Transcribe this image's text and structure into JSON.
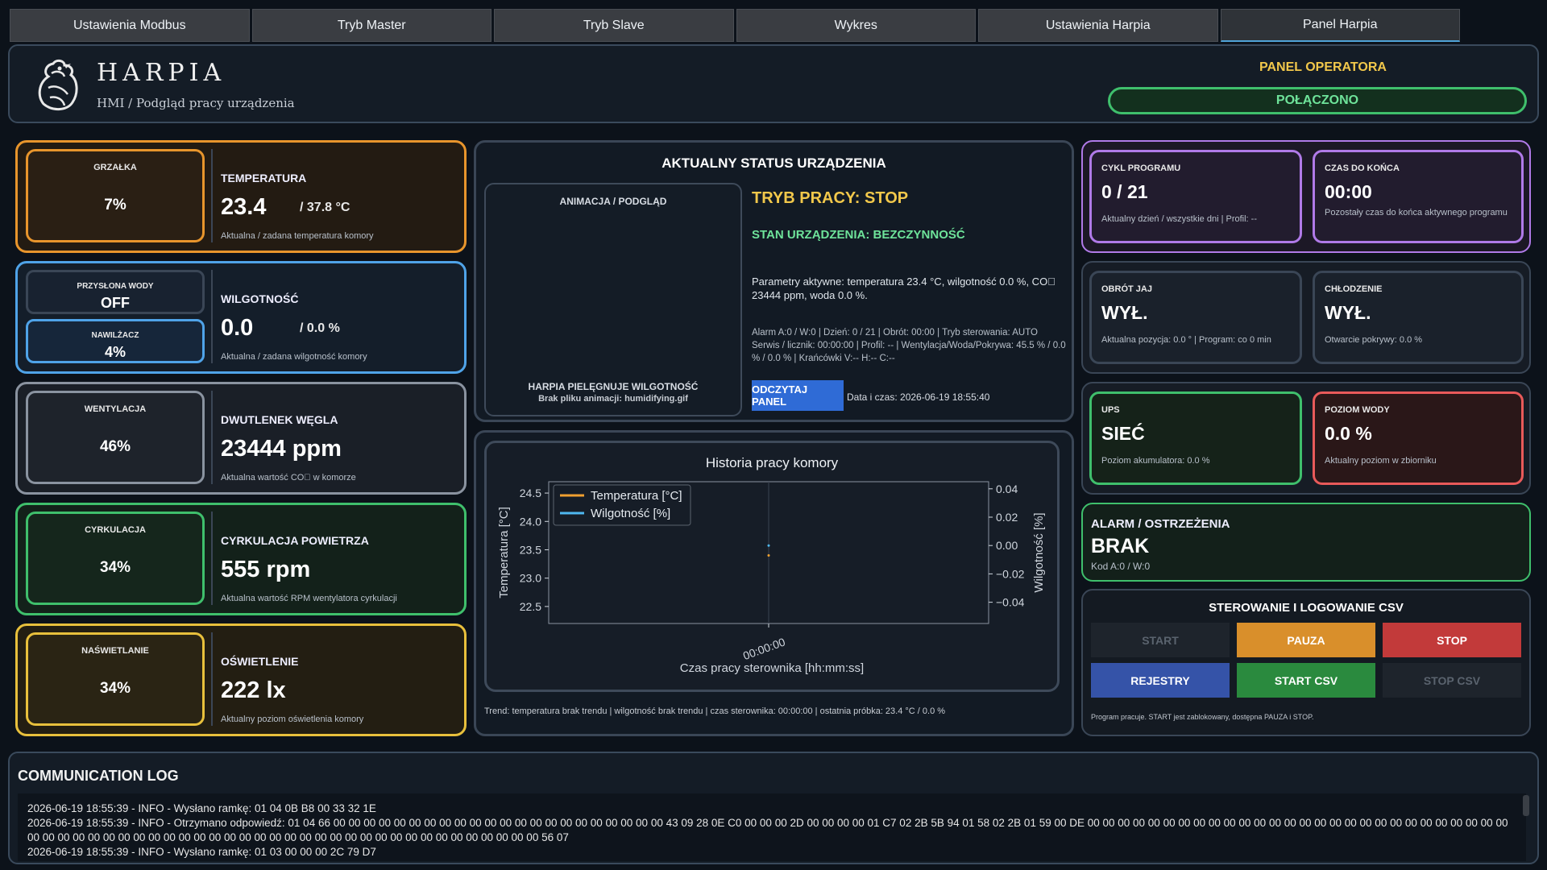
{
  "tabs": [
    "Ustawienia Modbus",
    "Tryb Master",
    "Tryb Slave",
    "Wykres",
    "Ustawienia Harpia",
    "Panel Harpia"
  ],
  "header": {
    "brand": "HARPIA",
    "subtitle": "HMI / Podgląd pracy urządzenia",
    "panel_title": "PANEL OPERATORA",
    "connection": "POŁĄCZONO",
    "logo_icon": "harpy-bird-logo"
  },
  "left": {
    "temp": {
      "mini_title": "GRZAŁKA",
      "mini_value": "7%",
      "label": "TEMPERATURA",
      "value": "23.4",
      "setpoint": "/  37.8 °C",
      "desc": "Aktualna / zadana temperatura komory",
      "color": "#e8952c"
    },
    "hum": {
      "mini1_title": "PRZYSŁONA WODY",
      "mini1_value": "OFF",
      "mini2_title": "NAWILŻACZ",
      "mini2_value": "4%",
      "label": "WILGOTNOŚĆ",
      "value": "0.0",
      "setpoint": "/  0.0 %",
      "desc": "Aktualna / zadana wilgotność komory",
      "color": "#4fa3e8"
    },
    "co2": {
      "mini_title": "WENTYLACJA",
      "mini_value": "46%",
      "label": "DWUTLENEK WĘGLA",
      "value": "23444 ppm",
      "desc": "Aktualna wartość CO⃞ w komorze",
      "color": "#8a93a0"
    },
    "circ": {
      "mini_title": "CYRKULACJA",
      "mini_value": "34%",
      "label": "CYRKULACJA POWIETRZA",
      "value": "555 rpm",
      "desc": "Aktualna wartość RPM wentylatora cyrkulacji",
      "color": "#3fbf6c"
    },
    "light": {
      "mini_title": "NAŚWIETLANIE",
      "mini_value": "34%",
      "label": "OŚWIETLENIE",
      "value": "222 lx",
      "desc": "Aktualny poziom oświetlenia komory",
      "color": "#e8c03c"
    }
  },
  "status": {
    "title": "AKTUALNY STATUS URZĄDZENIA",
    "anim_title": "ANIMACJA / PODGLĄD",
    "anim_caption": "HARPIA PIELĘGNUJE WILGOTNOŚĆ",
    "anim_missing": "Brak pliku animacji: humidifying.gif",
    "mode": "TRYB PRACY: STOP",
    "state": "STAN URZĄDZENIA: BEZCZYNNOŚĆ",
    "params": "Parametry aktywne: temperatura 23.4 °C, wilgotność 0.0 %, CO⃞ 23444 ppm, woda 0.0 %.",
    "meta": "Alarm A:0 / W:0  |  Dzień: 0 / 21  |  Obrót: 00:00  |  Tryb sterowania: AUTO\nSerwis / licznik: 00:00:00  |  Profil: --  |  Wentylacja/Woda/Pokrywa: 45.5 % / 0.0 % / 0.0 %  |  Krańcówki V:-- H:-- C:--",
    "read_button": "ODCZYTAJ PANEL",
    "datetime": "Data i czas: 2026-06-19  18:55:40"
  },
  "chart_data": {
    "type": "line",
    "title": "Historia pracy komory",
    "xlabel": "Czas pracy sterownika [hh:mm:ss]",
    "ylabel": "Temperatura [°C]",
    "y2label": "Wilgotność [%]",
    "x_ticks": [
      "00:00:00"
    ],
    "y_ticks": [
      "22.5",
      "23.0",
      "23.5",
      "24.0",
      "24.5"
    ],
    "y2_ticks": [
      "−0.04",
      "−0.02",
      "0.00",
      "0.02",
      "0.04"
    ],
    "ylim": [
      22.2,
      24.7
    ],
    "y2lim": [
      -0.055,
      0.045
    ],
    "series": [
      {
        "name": "Temperatura [°C]",
        "color": "#f0a030",
        "x": [
          "00:00:00"
        ],
        "values": [
          23.4
        ]
      },
      {
        "name": "Wilgotność [%]",
        "color": "#4fb8f0",
        "x": [
          "00:00:00"
        ],
        "values": [
          0.0
        ]
      }
    ],
    "legend": "top-left",
    "grid": true
  },
  "trend": "Trend: temperatura brak trendu  |  wilgotność brak trendu  |  czas sterownika: 00:00:00  |  ostatnia próbka: 23.4 °C / 0.0 %",
  "right": {
    "cycle": {
      "title": "CYKL PROGRAMU",
      "value": "0 / 21",
      "desc": "Aktualny dzień / wszystkie dni  |  Profil: --"
    },
    "remaining": {
      "title": "CZAS DO KOŃCA",
      "value": "00:00",
      "desc": "Pozostały czas do końca aktywnego programu"
    },
    "turn": {
      "title": "OBRÓT JAJ",
      "value": "WYŁ.",
      "desc": "Aktualna pozycja: 0.0 °  |  Program: co 0 min"
    },
    "cool": {
      "title": "CHŁODZENIE",
      "value": "WYŁ.",
      "desc": "Otwarcie pokrywy: 0.0 %"
    },
    "ups": {
      "title": "UPS",
      "value": "SIEĆ",
      "desc": "Poziom akumulatora: 0.0 %"
    },
    "water": {
      "title": "POZIOM WODY",
      "value": "0.0 %",
      "desc": "Aktualny poziom w zbiorniku"
    },
    "alarm": {
      "title": "ALARM / OSTRZEŻENIA",
      "value": "BRAK",
      "desc": "Kod A:0 / W:0"
    },
    "controls": {
      "title": "STEROWANIE I LOGOWANIE CSV",
      "start": "START",
      "pause": "PAUZA",
      "stop": "STOP",
      "registers": "REJESTRY",
      "start_csv": "START CSV",
      "stop_csv": "STOP CSV",
      "note": "Program pracuje. START jest zablokowany, dostępna PAUZA i STOP."
    }
  },
  "log": {
    "title": "COMMUNICATION LOG",
    "lines": [
      "2026-06-19 18:55:39 - INFO - Wysłano ramkę: 01 04 0B B8 00 33 32 1E",
      "2026-06-19 18:55:39 - INFO - Otrzymano odpowiedź: 01 04 66 00 00 00 00 00 00 00 00 00 00 00 00 00 00 00 00 00 00 00 00 00 00 43 09 28 0E C0 00 00 00 2D 00 00 00 00 01 C7 02 2B 5B 94 01 58 02 2B 01 59 00 DE 00 00 00 00 00 00 00 00 00 00 00 00 00 00 00 00 00 00 00 00 00 00 00 00 00 00 00 00 00 00 00 00 00 00 00 00 00 00 00 00 00 00 00 00 00 00 00 00 00 00 00 00 00 00 00 00 00 00 00 00 00 00 56 07",
      "2026-06-19 18:55:39 - INFO - Wysłano ramkę: 01 03 00 00 00 2C 79 D7"
    ]
  }
}
